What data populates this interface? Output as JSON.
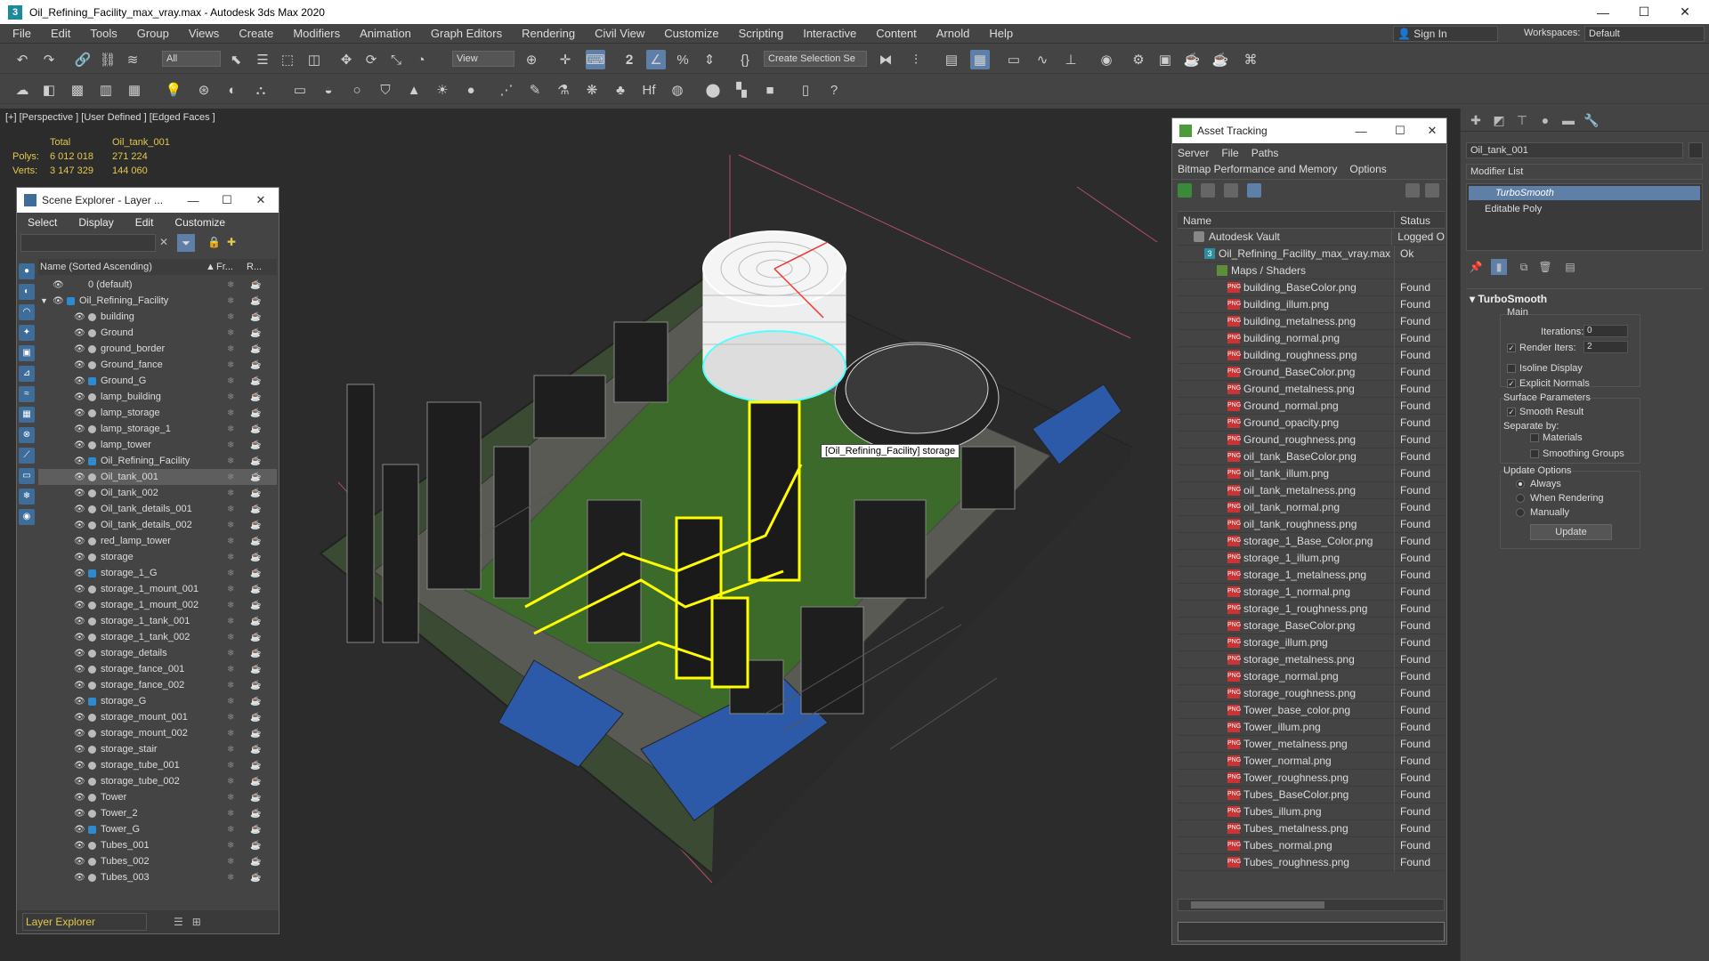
{
  "window": {
    "title": "Oil_Refining_Facility_max_vray.max - Autodesk 3ds Max 2020"
  },
  "menubar": {
    "items": [
      "File",
      "Edit",
      "Tools",
      "Group",
      "Views",
      "Create",
      "Modifiers",
      "Animation",
      "Graph Editors",
      "Rendering",
      "Civil View",
      "Customize",
      "Scripting",
      "Interactive",
      "Content",
      "Arnold",
      "Help"
    ],
    "sign_in": "Sign In",
    "workspaces_label": "Workspaces:",
    "workspaces_value": "Default"
  },
  "toolbar": {
    "selection_filter": "All",
    "ref_coord": "View",
    "named_selection": "Create Selection Se"
  },
  "viewport": {
    "label": "[+] [Perspective ] [User Defined ] [Edged Faces ]",
    "stats": {
      "header": [
        "Total",
        "Oil_tank_001"
      ],
      "polys_label": "Polys:",
      "polys_total": "6 012 018",
      "polys_sel": "271 224",
      "verts_label": "Verts:",
      "verts_total": "3 147 329",
      "verts_sel": "144 060"
    },
    "tooltip": "[Oil_Refining_Facility] storage"
  },
  "scene_explorer": {
    "title": "Scene Explorer - Layer ...",
    "menu": [
      "Select",
      "Display",
      "Edit",
      "Customize"
    ],
    "columns": {
      "name": "Name (Sorted Ascending)",
      "frozen": "Fr...",
      "render": "R..."
    },
    "rows": [
      {
        "name": "0 (default)",
        "level": 0,
        "type": "layer"
      },
      {
        "name": "Oil_Refining_Facility",
        "level": 0,
        "type": "layer",
        "expanded": true
      },
      {
        "name": "building",
        "level": 1,
        "type": "obj"
      },
      {
        "name": "Ground",
        "level": 1,
        "type": "obj"
      },
      {
        "name": "ground_border",
        "level": 1,
        "type": "obj"
      },
      {
        "name": "Ground_fance",
        "level": 1,
        "type": "obj"
      },
      {
        "name": "Ground_G",
        "level": 1,
        "type": "grp"
      },
      {
        "name": "lamp_building",
        "level": 1,
        "type": "obj"
      },
      {
        "name": "lamp_storage",
        "level": 1,
        "type": "obj"
      },
      {
        "name": "lamp_storage_1",
        "level": 1,
        "type": "obj"
      },
      {
        "name": "lamp_tower",
        "level": 1,
        "type": "obj"
      },
      {
        "name": "Oil_Refining_Facility",
        "level": 1,
        "type": "grp"
      },
      {
        "name": "Oil_tank_001",
        "level": 1,
        "type": "obj",
        "selected": true
      },
      {
        "name": "Oil_tank_002",
        "level": 1,
        "type": "obj"
      },
      {
        "name": "Oil_tank_details_001",
        "level": 1,
        "type": "obj"
      },
      {
        "name": "Oil_tank_details_002",
        "level": 1,
        "type": "obj"
      },
      {
        "name": "red_lamp_tower",
        "level": 1,
        "type": "obj"
      },
      {
        "name": "storage",
        "level": 1,
        "type": "obj"
      },
      {
        "name": "storage_1_G",
        "level": 1,
        "type": "grp"
      },
      {
        "name": "storage_1_mount_001",
        "level": 1,
        "type": "obj"
      },
      {
        "name": "storage_1_mount_002",
        "level": 1,
        "type": "obj"
      },
      {
        "name": "storage_1_tank_001",
        "level": 1,
        "type": "obj"
      },
      {
        "name": "storage_1_tank_002",
        "level": 1,
        "type": "obj"
      },
      {
        "name": "storage_details",
        "level": 1,
        "type": "obj"
      },
      {
        "name": "storage_fance_001",
        "level": 1,
        "type": "obj"
      },
      {
        "name": "storage_fance_002",
        "level": 1,
        "type": "obj"
      },
      {
        "name": "storage_G",
        "level": 1,
        "type": "grp"
      },
      {
        "name": "storage_mount_001",
        "level": 1,
        "type": "obj"
      },
      {
        "name": "storage_mount_002",
        "level": 1,
        "type": "obj"
      },
      {
        "name": "storage_stair",
        "level": 1,
        "type": "obj"
      },
      {
        "name": "storage_tube_001",
        "level": 1,
        "type": "obj"
      },
      {
        "name": "storage_tube_002",
        "level": 1,
        "type": "obj"
      },
      {
        "name": "Tower",
        "level": 1,
        "type": "obj"
      },
      {
        "name": "Tower_2",
        "level": 1,
        "type": "obj"
      },
      {
        "name": "Tower_G",
        "level": 1,
        "type": "grp"
      },
      {
        "name": "Tubes_001",
        "level": 1,
        "type": "obj"
      },
      {
        "name": "Tubes_002",
        "level": 1,
        "type": "obj"
      },
      {
        "name": "Tubes_003",
        "level": 1,
        "type": "obj"
      }
    ],
    "footer": "Layer Explorer"
  },
  "asset_tracking": {
    "title": "Asset Tracking",
    "menu1": [
      "Server",
      "File",
      "Paths"
    ],
    "menu2": [
      "Bitmap Performance and Memory",
      "Options"
    ],
    "columns": [
      "Name",
      "Status"
    ],
    "rows": [
      {
        "name": "Autodesk Vault",
        "status": "Logged O",
        "kind": "vault",
        "indent": 18
      },
      {
        "name": "Oil_Refining_Facility_max_vray.max",
        "status": "Ok",
        "kind": "max",
        "indent": 30
      },
      {
        "name": "Maps / Shaders",
        "status": "",
        "kind": "maps",
        "indent": 44
      },
      {
        "name": "building_BaseColor.png",
        "status": "Found",
        "kind": "png",
        "indent": 56
      },
      {
        "name": "building_illum.png",
        "status": "Found",
        "kind": "png",
        "indent": 56
      },
      {
        "name": "building_metalness.png",
        "status": "Found",
        "kind": "png",
        "indent": 56
      },
      {
        "name": "building_normal.png",
        "status": "Found",
        "kind": "png",
        "indent": 56
      },
      {
        "name": "building_roughness.png",
        "status": "Found",
        "kind": "png",
        "indent": 56
      },
      {
        "name": "Ground_BaseColor.png",
        "status": "Found",
        "kind": "png",
        "indent": 56
      },
      {
        "name": "Ground_metalness.png",
        "status": "Found",
        "kind": "png",
        "indent": 56
      },
      {
        "name": "Ground_normal.png",
        "status": "Found",
        "kind": "png",
        "indent": 56
      },
      {
        "name": "Ground_opacity.png",
        "status": "Found",
        "kind": "png",
        "indent": 56
      },
      {
        "name": "Ground_roughness.png",
        "status": "Found",
        "kind": "png",
        "indent": 56
      },
      {
        "name": "oil_tank_BaseColor.png",
        "status": "Found",
        "kind": "png",
        "indent": 56
      },
      {
        "name": "oil_tank_illum.png",
        "status": "Found",
        "kind": "png",
        "indent": 56
      },
      {
        "name": "oil_tank_metalness.png",
        "status": "Found",
        "kind": "png",
        "indent": 56
      },
      {
        "name": "oil_tank_normal.png",
        "status": "Found",
        "kind": "png",
        "indent": 56
      },
      {
        "name": "oil_tank_roughness.png",
        "status": "Found",
        "kind": "png",
        "indent": 56
      },
      {
        "name": "storage_1_Base_Color.png",
        "status": "Found",
        "kind": "png",
        "indent": 56
      },
      {
        "name": "storage_1_illum.png",
        "status": "Found",
        "kind": "png",
        "indent": 56
      },
      {
        "name": "storage_1_metalness.png",
        "status": "Found",
        "kind": "png",
        "indent": 56
      },
      {
        "name": "storage_1_normal.png",
        "status": "Found",
        "kind": "png",
        "indent": 56
      },
      {
        "name": "storage_1_roughness.png",
        "status": "Found",
        "kind": "png",
        "indent": 56
      },
      {
        "name": "storage_BaseColor.png",
        "status": "Found",
        "kind": "png",
        "indent": 56
      },
      {
        "name": "storage_illum.png",
        "status": "Found",
        "kind": "png",
        "indent": 56
      },
      {
        "name": "storage_metalness.png",
        "status": "Found",
        "kind": "png",
        "indent": 56
      },
      {
        "name": "storage_normal.png",
        "status": "Found",
        "kind": "png",
        "indent": 56
      },
      {
        "name": "storage_roughness.png",
        "status": "Found",
        "kind": "png",
        "indent": 56
      },
      {
        "name": "Tower_base_color.png",
        "status": "Found",
        "kind": "png",
        "indent": 56
      },
      {
        "name": "Tower_illum.png",
        "status": "Found",
        "kind": "png",
        "indent": 56
      },
      {
        "name": "Tower_metalness.png",
        "status": "Found",
        "kind": "png",
        "indent": 56
      },
      {
        "name": "Tower_normal.png",
        "status": "Found",
        "kind": "png",
        "indent": 56
      },
      {
        "name": "Tower_roughness.png",
        "status": "Found",
        "kind": "png",
        "indent": 56
      },
      {
        "name": "Tubes_BaseColor.png",
        "status": "Found",
        "kind": "png",
        "indent": 56
      },
      {
        "name": "Tubes_illum.png",
        "status": "Found",
        "kind": "png",
        "indent": 56
      },
      {
        "name": "Tubes_metalness.png",
        "status": "Found",
        "kind": "png",
        "indent": 56
      },
      {
        "name": "Tubes_normal.png",
        "status": "Found",
        "kind": "png",
        "indent": 56
      },
      {
        "name": "Tubes_roughness.png",
        "status": "Found",
        "kind": "png",
        "indent": 56
      }
    ]
  },
  "command_panel": {
    "object_name": "Oil_tank_001",
    "modifier_list": "Modifier List",
    "stack": [
      "TurboSmooth",
      "Editable Poly"
    ],
    "rollout_title": "TurboSmooth",
    "main_label": "Main",
    "iterations_label": "Iterations:",
    "iterations_value": "0",
    "render_iters_label": "Render Iters:",
    "render_iters_value": "2",
    "isoline_label": "Isoline Display",
    "explicit_normals_label": "Explicit Normals",
    "surface_params_label": "Surface Parameters",
    "smooth_result_label": "Smooth Result",
    "separate_by_label": "Separate by:",
    "materials_label": "Materials",
    "smoothing_groups_label": "Smoothing Groups",
    "update_options_label": "Update Options",
    "always_label": "Always",
    "when_rendering_label": "When Rendering",
    "manually_label": "Manually",
    "update_button": "Update"
  },
  "colors": {
    "accent": "#5e7fa7",
    "selection": "#ffff00",
    "stats": "#e6c84a",
    "grass": "#3b6a2a",
    "roof": "#2d5aa8"
  }
}
